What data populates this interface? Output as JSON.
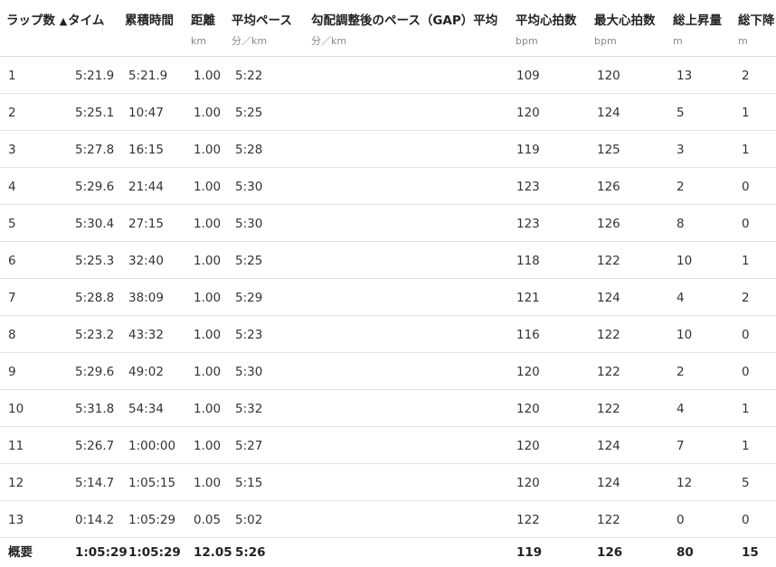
{
  "headers": [
    {
      "label": "ラップ数",
      "unit": ""
    },
    {
      "label": "タイム",
      "unit": "",
      "sort_icon": "▲"
    },
    {
      "label": "累積時間",
      "unit": ""
    },
    {
      "label": "距離",
      "unit": "km"
    },
    {
      "label": "平均ペース",
      "unit": "分／km"
    },
    {
      "label": "勾配調整後のペース（GAP）平均",
      "unit": "分／km"
    },
    {
      "label": "平均心拍数",
      "unit": "bpm"
    },
    {
      "label": "最大心拍数",
      "unit": "bpm"
    },
    {
      "label": "総上昇量",
      "unit": "m"
    },
    {
      "label": "総下降",
      "unit": "m"
    }
  ],
  "rows": [
    [
      "1",
      "5:21.9",
      "5:21.9",
      "1.00",
      "5:22",
      "",
      "109",
      "120",
      "13",
      "2"
    ],
    [
      "2",
      "5:25.1",
      "10:47",
      "1.00",
      "5:25",
      "",
      "120",
      "124",
      "5",
      "1"
    ],
    [
      "3",
      "5:27.8",
      "16:15",
      "1.00",
      "5:28",
      "",
      "119",
      "125",
      "3",
      "1"
    ],
    [
      "4",
      "5:29.6",
      "21:44",
      "1.00",
      "5:30",
      "",
      "123",
      "126",
      "2",
      "0"
    ],
    [
      "5",
      "5:30.4",
      "27:15",
      "1.00",
      "5:30",
      "",
      "123",
      "126",
      "8",
      "0"
    ],
    [
      "6",
      "5:25.3",
      "32:40",
      "1.00",
      "5:25",
      "",
      "118",
      "122",
      "10",
      "1"
    ],
    [
      "7",
      "5:28.8",
      "38:09",
      "1.00",
      "5:29",
      "",
      "121",
      "124",
      "4",
      "2"
    ],
    [
      "8",
      "5:23.2",
      "43:32",
      "1.00",
      "5:23",
      "",
      "116",
      "122",
      "10",
      "0"
    ],
    [
      "9",
      "5:29.6",
      "49:02",
      "1.00",
      "5:30",
      "",
      "120",
      "122",
      "2",
      "0"
    ],
    [
      "10",
      "5:31.8",
      "54:34",
      "1.00",
      "5:32",
      "",
      "120",
      "122",
      "4",
      "1"
    ],
    [
      "11",
      "5:26.7",
      "1:00:00",
      "1.00",
      "5:27",
      "",
      "120",
      "124",
      "7",
      "1"
    ],
    [
      "12",
      "5:14.7",
      "1:05:15",
      "1.00",
      "5:15",
      "",
      "120",
      "124",
      "12",
      "5"
    ],
    [
      "13",
      "0:14.2",
      "1:05:29",
      "0.05",
      "5:02",
      "",
      "122",
      "122",
      "0",
      "0"
    ]
  ],
  "summary": [
    "概要",
    "1:05:29",
    "1:05:29",
    "12.05",
    "5:26",
    "",
    "119",
    "126",
    "80",
    "15"
  ]
}
